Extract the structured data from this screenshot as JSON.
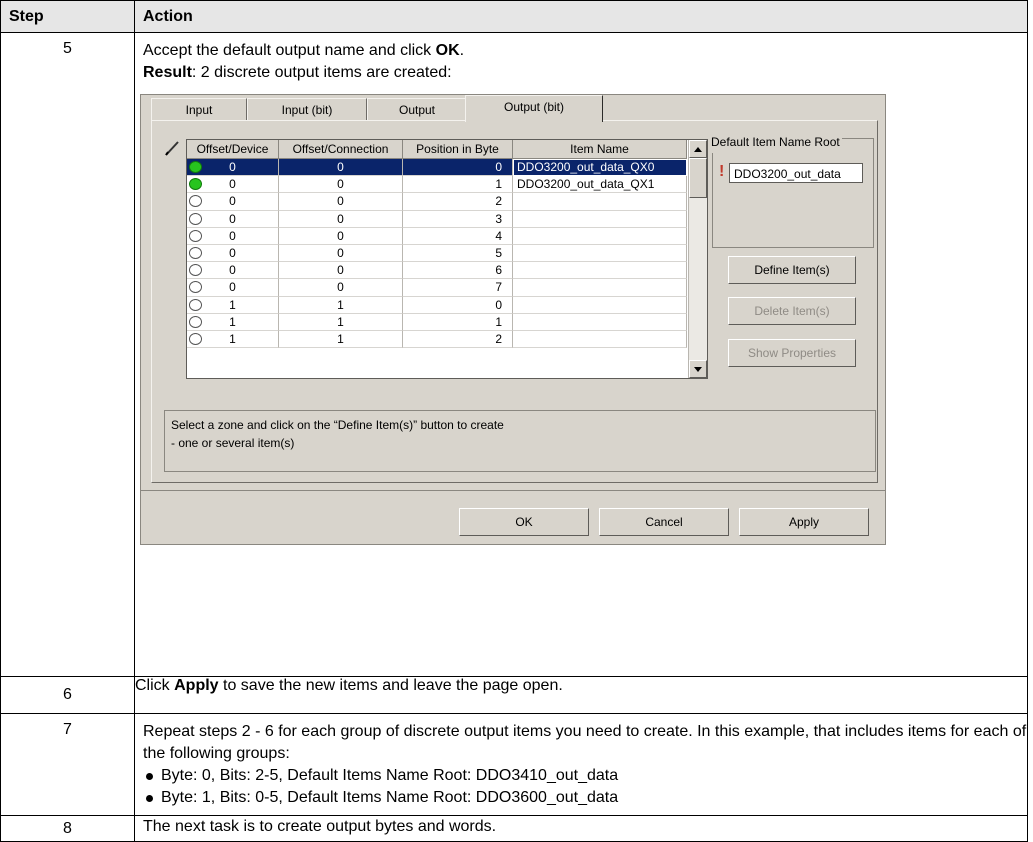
{
  "table": {
    "header": {
      "step": "Step",
      "action": "Action"
    },
    "rows": [
      {
        "step": "5",
        "line1_prefix": "Accept the default output name and click ",
        "line1_bold": "OK",
        "line1_suffix": ".",
        "line2_bold": "Result",
        "line2_text": ": 2 discrete output items are created:"
      },
      {
        "step": "6",
        "prefix": "Click ",
        "bold": "Apply",
        "suffix": " to save the new items and leave the page open."
      },
      {
        "step": "7",
        "text": "Repeat steps 2 - 6 for each group of discrete output items you need to create. In this example, that includes items for each of the following groups:",
        "bullets": [
          "Byte: 0, Bits: 2-5, Default Items Name Root: DDO3410_out_data",
          "Byte: 1, Bits: 0-5, Default Items Name Root: DDO3600_out_data"
        ]
      },
      {
        "step": "8",
        "text": "The next task is to create output bytes and words."
      }
    ]
  },
  "dialog": {
    "tabs": [
      "Input",
      "Input (bit)",
      "Output",
      "Output (bit)"
    ],
    "active_tab": 3,
    "grid_headers": [
      "Offset/Device",
      "Offset/Connection",
      "Position in Byte",
      "Item Name"
    ],
    "grid_rows": [
      {
        "status": "on",
        "offset_device": "0",
        "offset_connection": "0",
        "position": "0",
        "item_name": "DDO3200_out_data_QX0",
        "selected": true
      },
      {
        "status": "on",
        "offset_device": "0",
        "offset_connection": "0",
        "position": "1",
        "item_name": "DDO3200_out_data_QX1",
        "selected": false
      },
      {
        "status": "off",
        "offset_device": "0",
        "offset_connection": "0",
        "position": "2",
        "item_name": "",
        "selected": false
      },
      {
        "status": "off",
        "offset_device": "0",
        "offset_connection": "0",
        "position": "3",
        "item_name": "",
        "selected": false
      },
      {
        "status": "off",
        "offset_device": "0",
        "offset_connection": "0",
        "position": "4",
        "item_name": "",
        "selected": false
      },
      {
        "status": "off",
        "offset_device": "0",
        "offset_connection": "0",
        "position": "5",
        "item_name": "",
        "selected": false
      },
      {
        "status": "off",
        "offset_device": "0",
        "offset_connection": "0",
        "position": "6",
        "item_name": "",
        "selected": false
      },
      {
        "status": "off",
        "offset_device": "0",
        "offset_connection": "0",
        "position": "7",
        "item_name": "",
        "selected": false
      },
      {
        "status": "off",
        "offset_device": "1",
        "offset_connection": "1",
        "position": "0",
        "item_name": "",
        "selected": false
      },
      {
        "status": "off",
        "offset_device": "1",
        "offset_connection": "1",
        "position": "1",
        "item_name": "",
        "selected": false
      },
      {
        "status": "off",
        "offset_device": "1",
        "offset_connection": "1",
        "position": "2",
        "item_name": "",
        "selected": false
      }
    ],
    "default_root_label": "Default Item Name Root",
    "default_root_value": "DDO3200_out_data",
    "buttons": {
      "define": "Define Item(s)",
      "delete": "Delete Item(s)",
      "show_properties": "Show Properties",
      "ok": "OK",
      "cancel": "Cancel",
      "apply": "Apply"
    },
    "message_line1": "Select a zone and click on the “Define Item(s)” button to create",
    "message_line2": "- one or several item(s)",
    "colors": {
      "selection": "#0a246a",
      "status_on": "#27c41e",
      "dialog_bg": "#d8d4cc"
    }
  }
}
